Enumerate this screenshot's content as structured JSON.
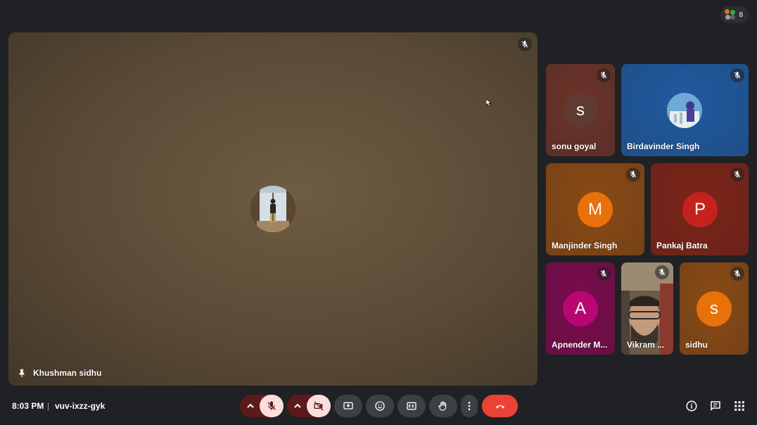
{
  "topbar": {
    "participant_count": "8",
    "icon": "people-icon"
  },
  "main": {
    "participant_name": "Khushman sidhu",
    "pin_icon": "pin-icon",
    "muted": true
  },
  "tiles": [
    {
      "name": "sonu goyal",
      "initial": "s",
      "avatar_color": "#5f3a33",
      "bg": "#6b3328",
      "muted": true
    },
    {
      "name": "Birdavinder Singh",
      "initial": "",
      "avatar_color": "#4a90c8",
      "bg": "#1f5aa0",
      "muted": true
    },
    {
      "name": "Manjinder Singh",
      "initial": "M",
      "avatar_color": "#e8710a",
      "bg": "#8a4a14",
      "muted": true
    },
    {
      "name": "Pankaj Batra",
      "initial": "P",
      "avatar_color": "#c5221f",
      "bg": "#7d2418",
      "muted": true
    },
    {
      "name": "Apnender M...",
      "initial": "A",
      "avatar_color": "#b80672",
      "bg": "#7a0b4d",
      "muted": true
    },
    {
      "name": "Vikram ...",
      "initial": "",
      "avatar_color": "",
      "bg": "#5a4e42",
      "muted": true
    },
    {
      "name": "sidhu",
      "initial": "s",
      "avatar_color": "#e8710a",
      "bg": "#8a4a14",
      "muted": true
    }
  ],
  "bottombar": {
    "time": "8:03 PM",
    "separator": "|",
    "meeting_code": "vuv-ixzz-gyk",
    "controls": [
      "audio-options-chevron",
      "microphone-off",
      "video-options-chevron",
      "camera-off",
      "present-screen",
      "emoji-reactions",
      "captions",
      "raise-hand",
      "more-options",
      "leave-call"
    ],
    "right_controls": [
      "meeting-details",
      "chat",
      "activities"
    ]
  },
  "colors": {
    "background": "#202124",
    "danger": "#ea4335",
    "muted_bg": "#f9dedc",
    "muted_dark": "#5c1a1a",
    "control_bg": "#3c4043"
  }
}
